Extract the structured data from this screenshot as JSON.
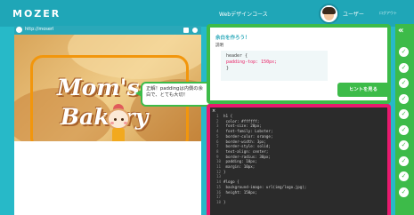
{
  "app": {
    "logo": "MOZER",
    "course": "Webデザインコース",
    "user": "ユーザー",
    "logout": "ログアウト"
  },
  "preview": {
    "url": "http://moserl",
    "brand_line1": "Mom's",
    "brand_line2": "Bakery",
    "tooltip": "正解！paddingは内側の余白で、とても大切！"
  },
  "question": {
    "title": "余白を作ろう！",
    "label": "説明",
    "code_lines": [
      "header {",
      "  padding-top: 150px;",
      "}"
    ],
    "hint_label": "ヒントを見る"
  },
  "editor": {
    "close": "×",
    "lines": [
      {
        "n": "1",
        "text": "h1 {"
      },
      {
        "n": "2",
        "text": "  color: #ffffff;"
      },
      {
        "n": "3",
        "text": "  font-size: 20px;"
      },
      {
        "n": "4",
        "text": "  font-family: Lobster;"
      },
      {
        "n": "5",
        "text": "  border-color: orange;"
      },
      {
        "n": "6",
        "text": "  border-width: 3px;"
      },
      {
        "n": "7",
        "text": "  border-style: solid;"
      },
      {
        "n": "8",
        "text": "  text-align: center;"
      },
      {
        "n": "9",
        "text": "  border-radius: 30px;"
      },
      {
        "n": "10",
        "text": "  padding: 10px;"
      },
      {
        "n": "11",
        "text": "  margin: 10px;"
      },
      {
        "n": "12",
        "text": "}"
      },
      {
        "n": "13",
        "text": ""
      },
      {
        "n": "14",
        "text": "#logo {"
      },
      {
        "n": "15",
        "text": "  background-image: url(img/logo.jpg);"
      },
      {
        "n": "16",
        "text": "  height: 150px;"
      },
      {
        "n": "17",
        "text": ""
      },
      {
        "n": "18",
        "text": "}"
      }
    ]
  },
  "sidebar": {
    "toggle": "«",
    "check_glyph": "✓",
    "checks": [
      "done",
      "done",
      "done",
      "done",
      "done",
      "done",
      "done",
      "done",
      "done",
      "done"
    ]
  },
  "colors": {
    "background": "#27b9c8",
    "accent_green": "#3dbb49",
    "accent_pink": "#e8196e",
    "orange_outline": "#f2960c"
  }
}
